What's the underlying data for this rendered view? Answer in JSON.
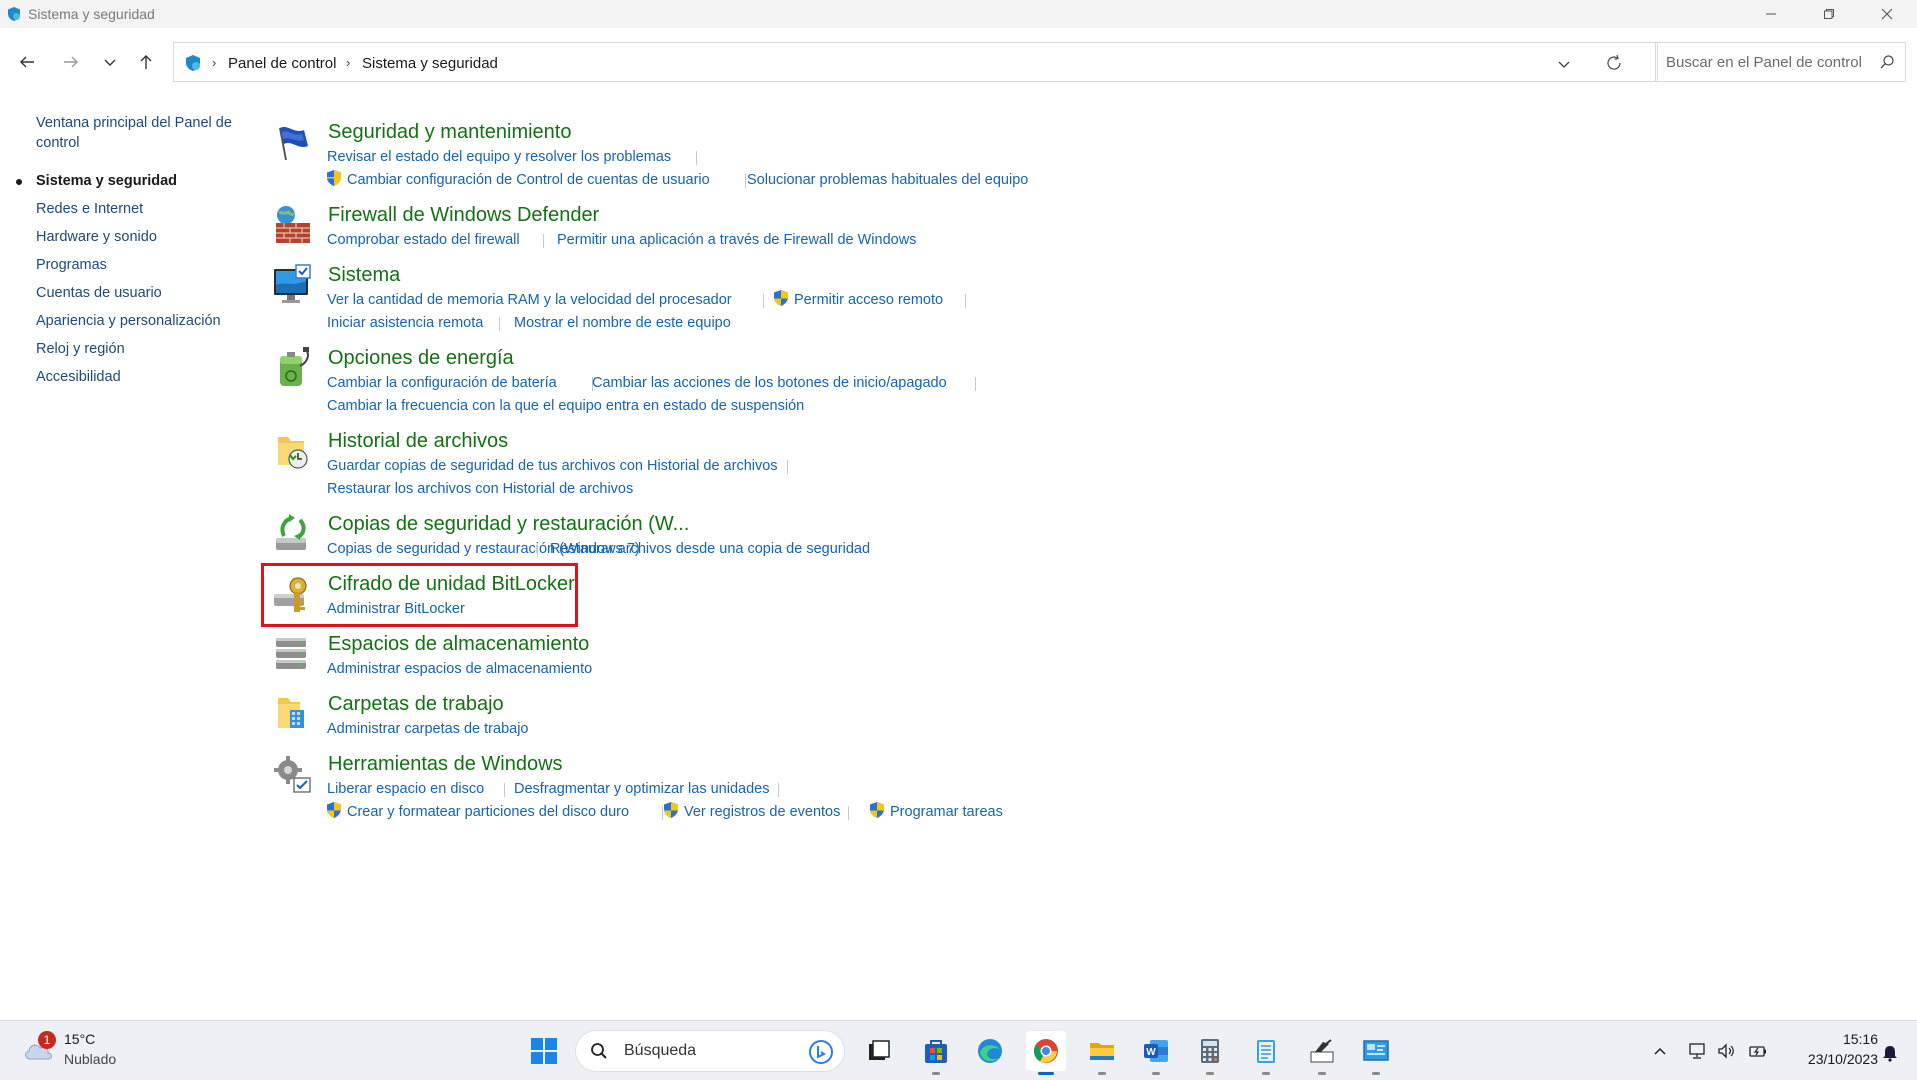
{
  "window": {
    "title": "Sistema y seguridad"
  },
  "address": {
    "crumbs": [
      "Panel de control",
      "Sistema y seguridad"
    ]
  },
  "search": {
    "placeholder": "Buscar en el Panel de control"
  },
  "sidebar": {
    "items": [
      {
        "label": "Ventana principal del Panel de",
        "label2": "control"
      },
      {
        "label": "Sistema y seguridad",
        "current": true
      },
      {
        "label": "Redes e Internet"
      },
      {
        "label": "Hardware y sonido"
      },
      {
        "label": "Programas"
      },
      {
        "label": "Cuentas de usuario"
      },
      {
        "label": "Apariencia y personalización"
      },
      {
        "label": "Reloj y región"
      },
      {
        "label": "Accesibilidad"
      }
    ]
  },
  "categories": [
    {
      "title": "Seguridad y mantenimiento",
      "links": [
        "Revisar el estado del equipo y resolver los problemas",
        "Cambiar configuración de Control de cuentas de usuario",
        "Solucionar problemas habituales del equipo"
      ]
    },
    {
      "title": "Firewall de Windows Defender",
      "links": [
        "Comprobar estado del firewall",
        "Permitir una aplicación a través de Firewall de Windows"
      ]
    },
    {
      "title": "Sistema",
      "links": [
        "Ver la cantidad de memoria RAM y la velocidad del procesador",
        "Permitir acceso remoto",
        "Iniciar asistencia remota",
        "Mostrar el nombre de este equipo"
      ]
    },
    {
      "title": "Opciones de energía",
      "links": [
        "Cambiar la configuración de batería",
        "Cambiar las acciones de los botones de inicio/apagado",
        "Cambiar la frecuencia con la que el equipo entra en estado de suspensión"
      ]
    },
    {
      "title": "Historial de archivos",
      "links": [
        "Guardar copias de seguridad de tus archivos con Historial de archivos",
        "Restaurar los archivos con Historial de archivos"
      ]
    },
    {
      "title": "Copias de seguridad y restauración (W...",
      "links": [
        "Copias de seguridad y restauración (Windows 7)",
        "Restaurar archivos desde una copia de seguridad"
      ]
    },
    {
      "title": "Cifrado de unidad BitLocker",
      "links": [
        "Administrar BitLocker"
      ]
    },
    {
      "title": "Espacios de almacenamiento",
      "links": [
        "Administrar espacios de almacenamiento"
      ]
    },
    {
      "title": "Carpetas de trabajo",
      "links": [
        "Administrar carpetas de trabajo"
      ]
    },
    {
      "title": "Herramientas de Windows",
      "links": [
        "Liberar espacio en disco",
        "Desfragmentar y optimizar las unidades",
        "Crear y formatear particiones del disco duro",
        "Ver registros de eventos",
        "Programar tareas"
      ]
    }
  ],
  "taskbar": {
    "weather_badge": "1",
    "temperature": "15°C",
    "condition": "Nublado",
    "search_label": "Búsqueda",
    "time": "15:16",
    "date": "23/10/2023"
  },
  "colors": {
    "category_title": "#127212",
    "link": "#1564b0",
    "highlight_border": "#e1121c"
  }
}
